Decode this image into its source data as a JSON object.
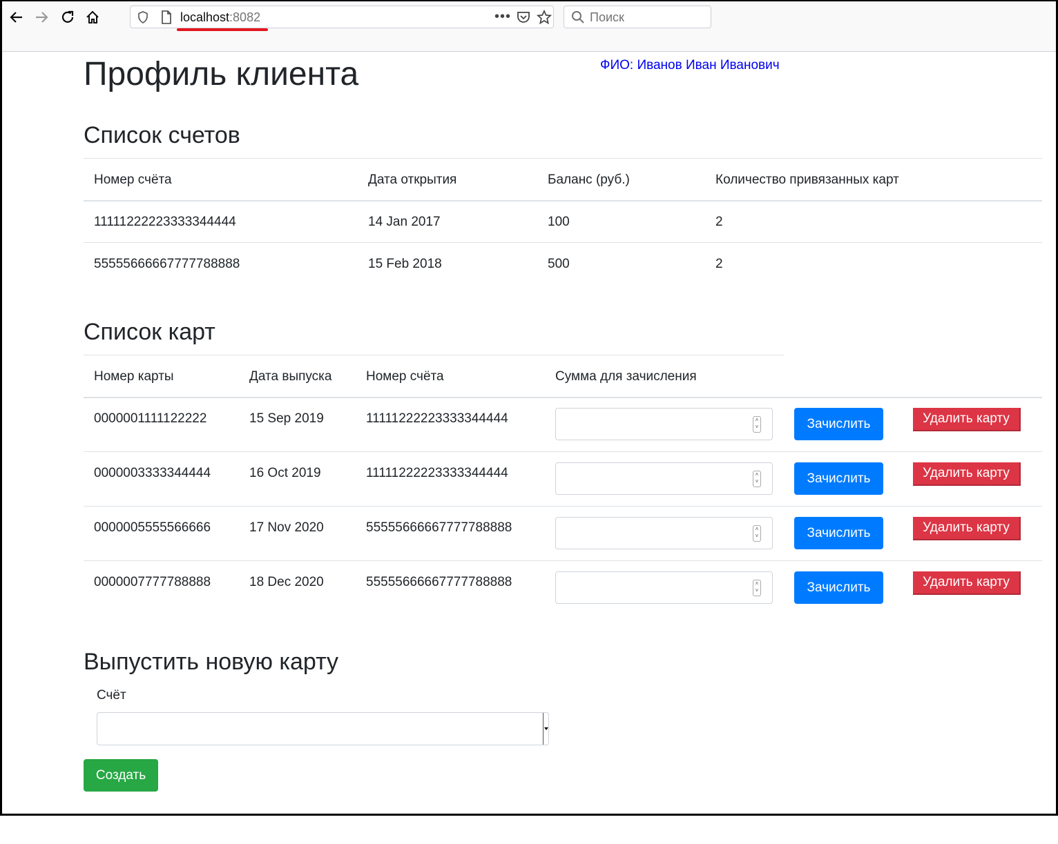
{
  "browser": {
    "url_host": "localhost",
    "url_port": ":8082",
    "search_placeholder": "Поиск"
  },
  "page": {
    "title": "Профиль клиента",
    "fio": "ФИО: Иванов Иван Иванович"
  },
  "accounts": {
    "heading": "Список счетов",
    "columns": [
      "Номер счёта",
      "Дата открытия",
      "Баланс (руб.)",
      "Количество привязанных карт"
    ],
    "rows": [
      [
        "11111222223333344444",
        "14 Jan 2017",
        "100",
        "2"
      ],
      [
        "55555666667777788888",
        "15 Feb 2018",
        "500",
        "2"
      ]
    ]
  },
  "cards": {
    "heading": "Список карт",
    "columns": [
      "Номер карты",
      "Дата выпуска",
      "Номер счёта",
      "Сумма для зачисления"
    ],
    "rows": [
      [
        "0000001111122222",
        "15 Sep 2019",
        "11111222223333344444"
      ],
      [
        "0000003333344444",
        "16 Oct 2019",
        "11111222223333344444"
      ],
      [
        "0000005555566666",
        "17 Nov 2020",
        "55555666667777788888"
      ],
      [
        "0000007777788888",
        "18 Dec 2020",
        "55555666667777788888"
      ]
    ],
    "deposit_label": "Зачислить",
    "delete_label": "Удалить карту"
  },
  "new_card": {
    "heading": "Выпустить новую карту",
    "account_label": "Счёт",
    "account_value": "",
    "create_label": "Создать"
  }
}
